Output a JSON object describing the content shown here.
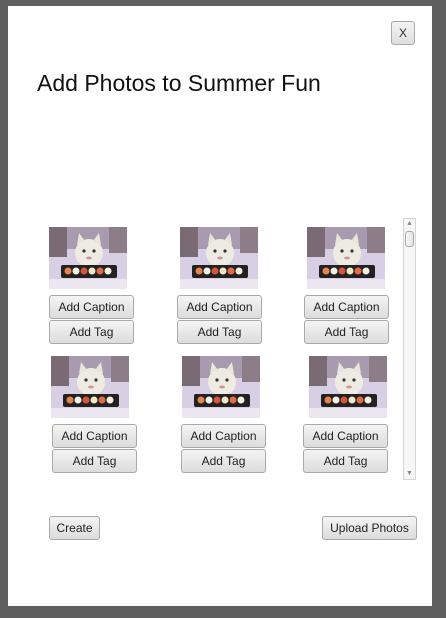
{
  "window": {
    "close_label": "X",
    "title": "Add Photos to Summer Fun"
  },
  "photos": [
    {
      "image": "cat-with-sushi-photo",
      "caption_label": "Add Caption",
      "tag_label": "Add Tag"
    },
    {
      "image": "cat-with-sushi-photo",
      "caption_label": "Add Caption",
      "tag_label": "Add Tag"
    },
    {
      "image": "cat-with-sushi-photo",
      "caption_label": "Add Caption",
      "tag_label": "Add Tag"
    },
    {
      "image": "cat-with-sushi-photo",
      "caption_label": "Add Caption",
      "tag_label": "Add Tag"
    },
    {
      "image": "cat-with-sushi-photo",
      "caption_label": "Add Caption",
      "tag_label": "Add Tag"
    },
    {
      "image": "cat-with-sushi-photo",
      "caption_label": "Add Caption",
      "tag_label": "Add Tag"
    }
  ],
  "scrollbar": {
    "up_icon": "chevron-up-icon",
    "down_icon": "chevron-down-icon"
  },
  "footer": {
    "create_label": "Create",
    "upload_label": "Upload Photos"
  }
}
